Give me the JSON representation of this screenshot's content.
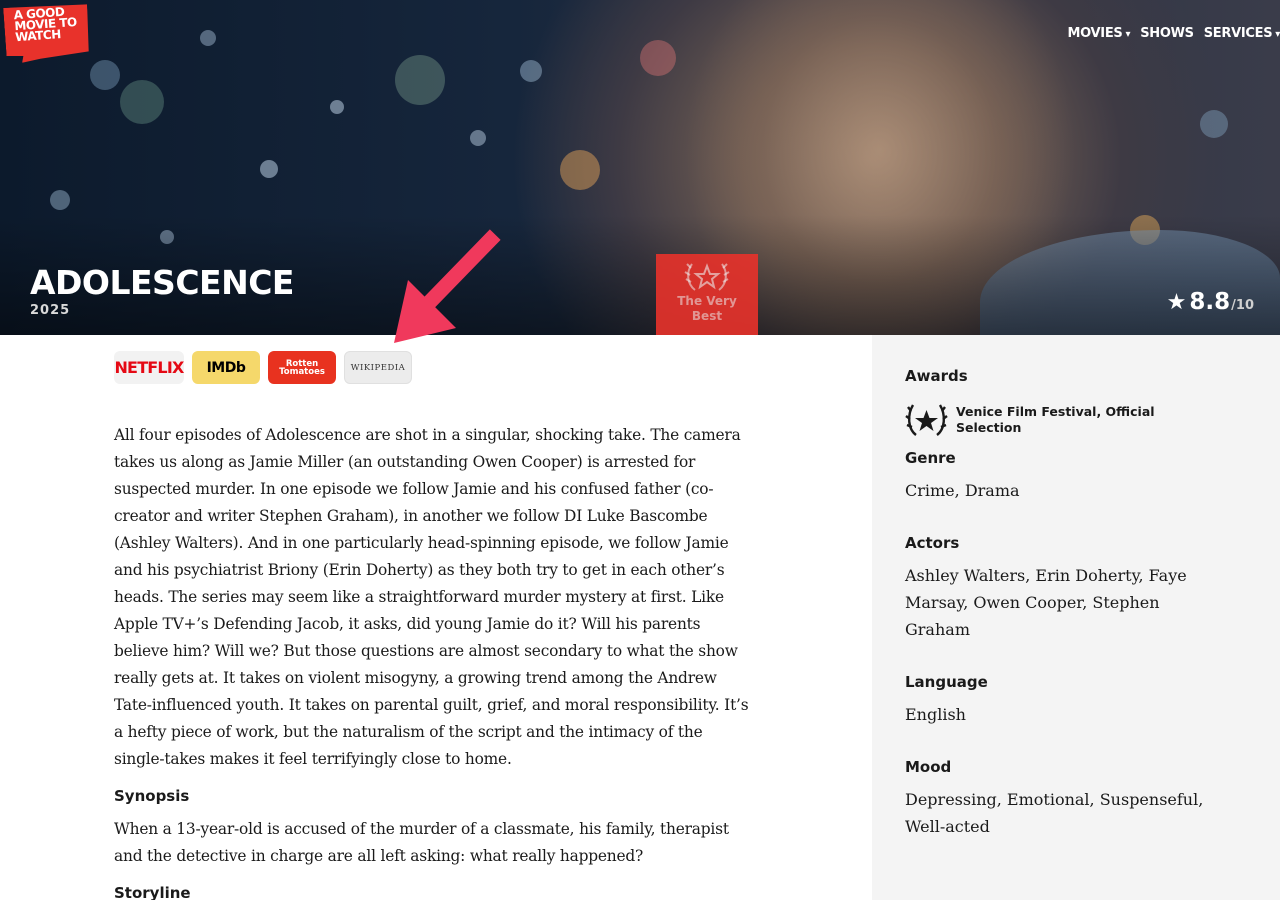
{
  "logo": {
    "lines": [
      "A GOOD",
      "MOVIE TO",
      "WATCH"
    ]
  },
  "nav": [
    {
      "label": "MOVIES",
      "caret": "▾"
    },
    {
      "label": "SHOWS",
      "caret": ""
    },
    {
      "label": "SERVICES",
      "caret": "▾"
    }
  ],
  "hero": {
    "title": "ADOLESCENCE",
    "year": "2025",
    "badge": {
      "line1": "The Very",
      "line2": "Best",
      "icon": "laurel-star-icon"
    },
    "rating": {
      "star": "★",
      "score": "8.8",
      "out_of": "/10"
    }
  },
  "sources": [
    {
      "label": "NETFLIX",
      "icon": "netflix-logo"
    },
    {
      "label": "IMDb",
      "icon": "imdb-logo"
    },
    {
      "label_line1": "Rotten",
      "label_line2": "Tomatoes",
      "icon": "rotten-tomatoes-logo"
    },
    {
      "label": "WIKIPEDIA",
      "icon": "wikipedia-logo"
    }
  ],
  "article": {
    "review": "All four episodes of Adolescence are shot in a singular, shocking take. The camera takes us along as Jamie Miller (an outstanding Owen Cooper) is arrested for suspected murder. In one episode we follow Jamie and his confused father (co-creator and writer Stephen Graham), in another we follow DI Luke Bascombe (Ashley Walters). And in one particularly head-spinning episode, we follow Jamie and his psychiatrist Briony (Erin Doherty) as they both try to get in each other’s heads. The series may seem like a straightforward murder mystery at first. Like Apple TV+’s Defending Jacob, it asks, did young Jamie do it? Will his parents believe him? Will we? But those questions are almost secondary to what the show really gets at. It takes on violent misogyny, a growing trend among the Andrew Tate-influenced youth. It takes on parental guilt, grief, and moral responsibility. It’s a hefty piece of work, but the naturalism of the script and the intimacy of the single-takes makes it feel terrifyingly close to home.",
    "synopsis_heading": "Synopsis",
    "synopsis": "When a 13-year-old is accused of the murder of a classmate, his family, therapist and the detective in charge are all left asking: what really happened?",
    "storyline_heading": "Storyline"
  },
  "sidebar": {
    "awards_heading": "Awards",
    "award_text": "Venice Film Festival, Official Selection",
    "award_icon": "laurel-star-icon",
    "genre_heading": "Genre",
    "genre": "Crime, Drama",
    "actors_heading": "Actors",
    "actors": "Ashley Walters, Erin Doherty, Faye Marsay, Owen Cooper, Stephen Graham",
    "language_heading": "Language",
    "language": "English",
    "mood_heading": "Mood",
    "mood": "Depressing, Emotional, Suspenseful, Well-acted"
  },
  "colors": {
    "brand_red": "#e8322b",
    "annotation_pink": "#f0395c",
    "sidebar_bg": "#f4f4f4"
  }
}
